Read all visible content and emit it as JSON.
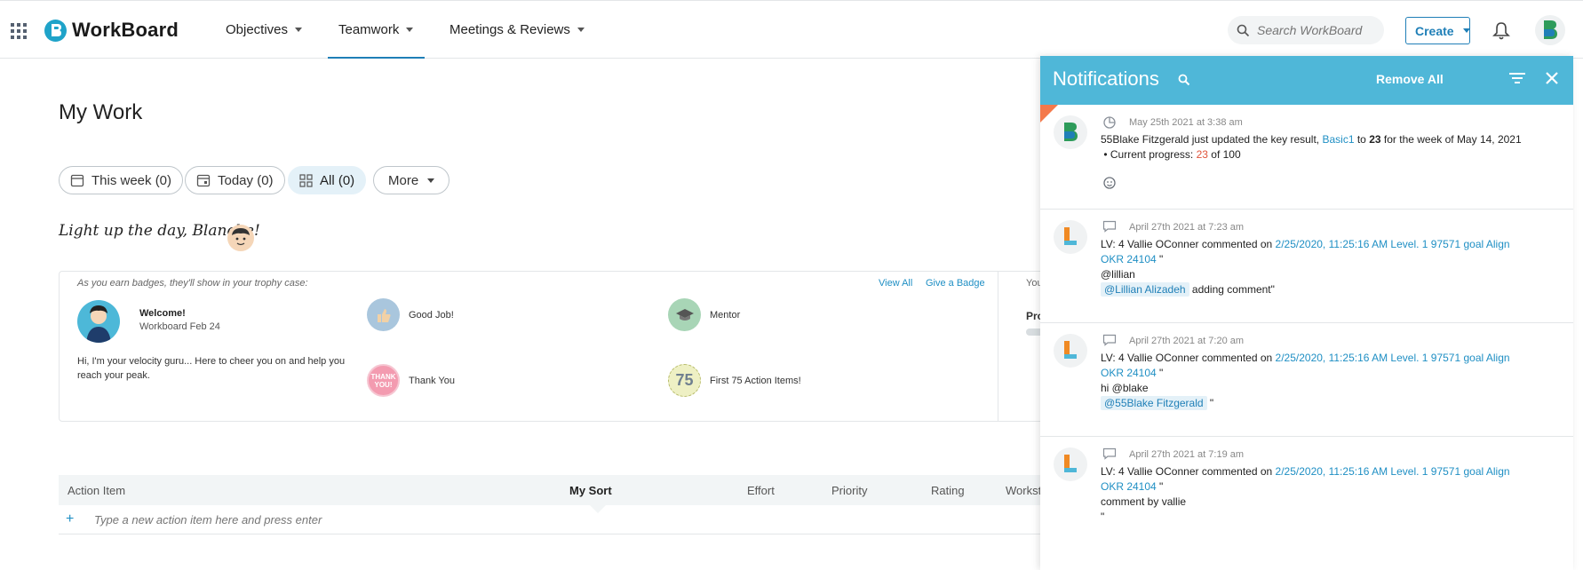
{
  "app": {
    "name": "WorkBoard",
    "nav": [
      {
        "label": "Objectives"
      },
      {
        "label": "Teamwork"
      },
      {
        "label": "Meetings & Reviews"
      }
    ],
    "search_placeholder": "Search WorkBoard",
    "create_label": "Create"
  },
  "page": {
    "title": "My Work",
    "filters": {
      "this_week": "This week (0)",
      "today": "Today (0)",
      "all": "All (0)",
      "more": "More"
    },
    "greeting": "Light up the day, Blanche!"
  },
  "badges": {
    "hint": "As you earn badges, they'll show in your trophy case:",
    "view_all": "View All",
    "give_badge": "Give a Badge",
    "right_text": "You",
    "right_pro": "Pro",
    "guru_title": "Welcome!",
    "guru_sub": "Workboard Feb 24",
    "guru_text": "Hi, I'm your velocity guru... Here to cheer you on and help you reach your peak.",
    "items": [
      {
        "label": "Good Job!"
      },
      {
        "label": "Mentor"
      },
      {
        "label": "Thank You",
        "icon_text": "THANK YOU!"
      },
      {
        "label": "First 75 Action Items!",
        "icon_text": "75"
      }
    ]
  },
  "table": {
    "columns": [
      "Action Item",
      "My Sort",
      "Effort",
      "Priority",
      "Rating",
      "Workst"
    ],
    "new_placeholder": "Type a new action item here and press enter"
  },
  "notifications": {
    "title": "Notifications",
    "remove_all": "Remove All",
    "items": [
      {
        "avatar": "B",
        "time": "May 25th 2021 at 3:38 am",
        "p1": "55Blake Fitzgerald just updated the key result, ",
        "link": "Basic1",
        "p2": " to ",
        "value": "23",
        "p3": " for the week of May 14, 2021",
        "progress_label": "Current progress: ",
        "progress_value": "23",
        "progress_total": " of 100"
      },
      {
        "avatar": "L",
        "time": "April 27th 2021 at 7:23 am",
        "prefix": "LV: 4 Vallie OConner commented on ",
        "link1": "2/25/2020, 11:25:16 AM Level. 1 97571 goal Align",
        "link2": "OKR 24104",
        "after_link": " \"",
        "line3": "@lillian",
        "mention": "@Lillian Alizadeh",
        "line4_after": " adding comment\""
      },
      {
        "avatar": "L",
        "time": "April 27th 2021 at 7:20 am",
        "prefix": "LV: 4 Vallie OConner commented on ",
        "link1": "2/25/2020, 11:25:16 AM Level. 1 97571 goal Align",
        "link2": "OKR 24104",
        "after_link": " \"",
        "line3": "hi @blake",
        "mention": "@55Blake Fitzgerald",
        "line4_after": " \""
      },
      {
        "avatar": "L",
        "time": "April 27th 2021 at 7:19 am",
        "prefix": "LV: 4 Vallie OConner commented on ",
        "link1": "2/25/2020, 11:25:16 AM Level. 1 97571 goal Align",
        "link2": "OKR 24104",
        "after_link": " \"",
        "line3": "comment by vallie",
        "line4": "\""
      }
    ]
  },
  "colors": {
    "accent": "#1f7fb7",
    "notif_header": "#4fb7d8",
    "link": "#1f8fc4",
    "highlight": "#e0533a"
  }
}
